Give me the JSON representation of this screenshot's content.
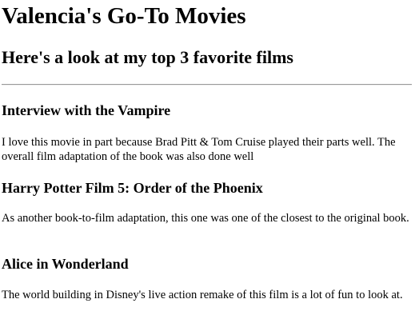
{
  "header": {
    "title": "Valencia's Go-To Movies",
    "subtitle": "Here's a look at my top 3 favorite films"
  },
  "films": [
    {
      "title": "Interview with the Vampire",
      "description": "I love this movie in part because Brad Pitt & Tom Cruise played their parts well. The overall film adaptation of the book was also done well"
    },
    {
      "title": "Harry Potter Film 5: Order of the Phoenix",
      "description": "As another book-to-film adaptation, this one was one of the closest to the original book."
    },
    {
      "title": "Alice in Wonderland",
      "description": "The world building in Disney's live action remake of this film is a lot of fun to look at."
    }
  ]
}
